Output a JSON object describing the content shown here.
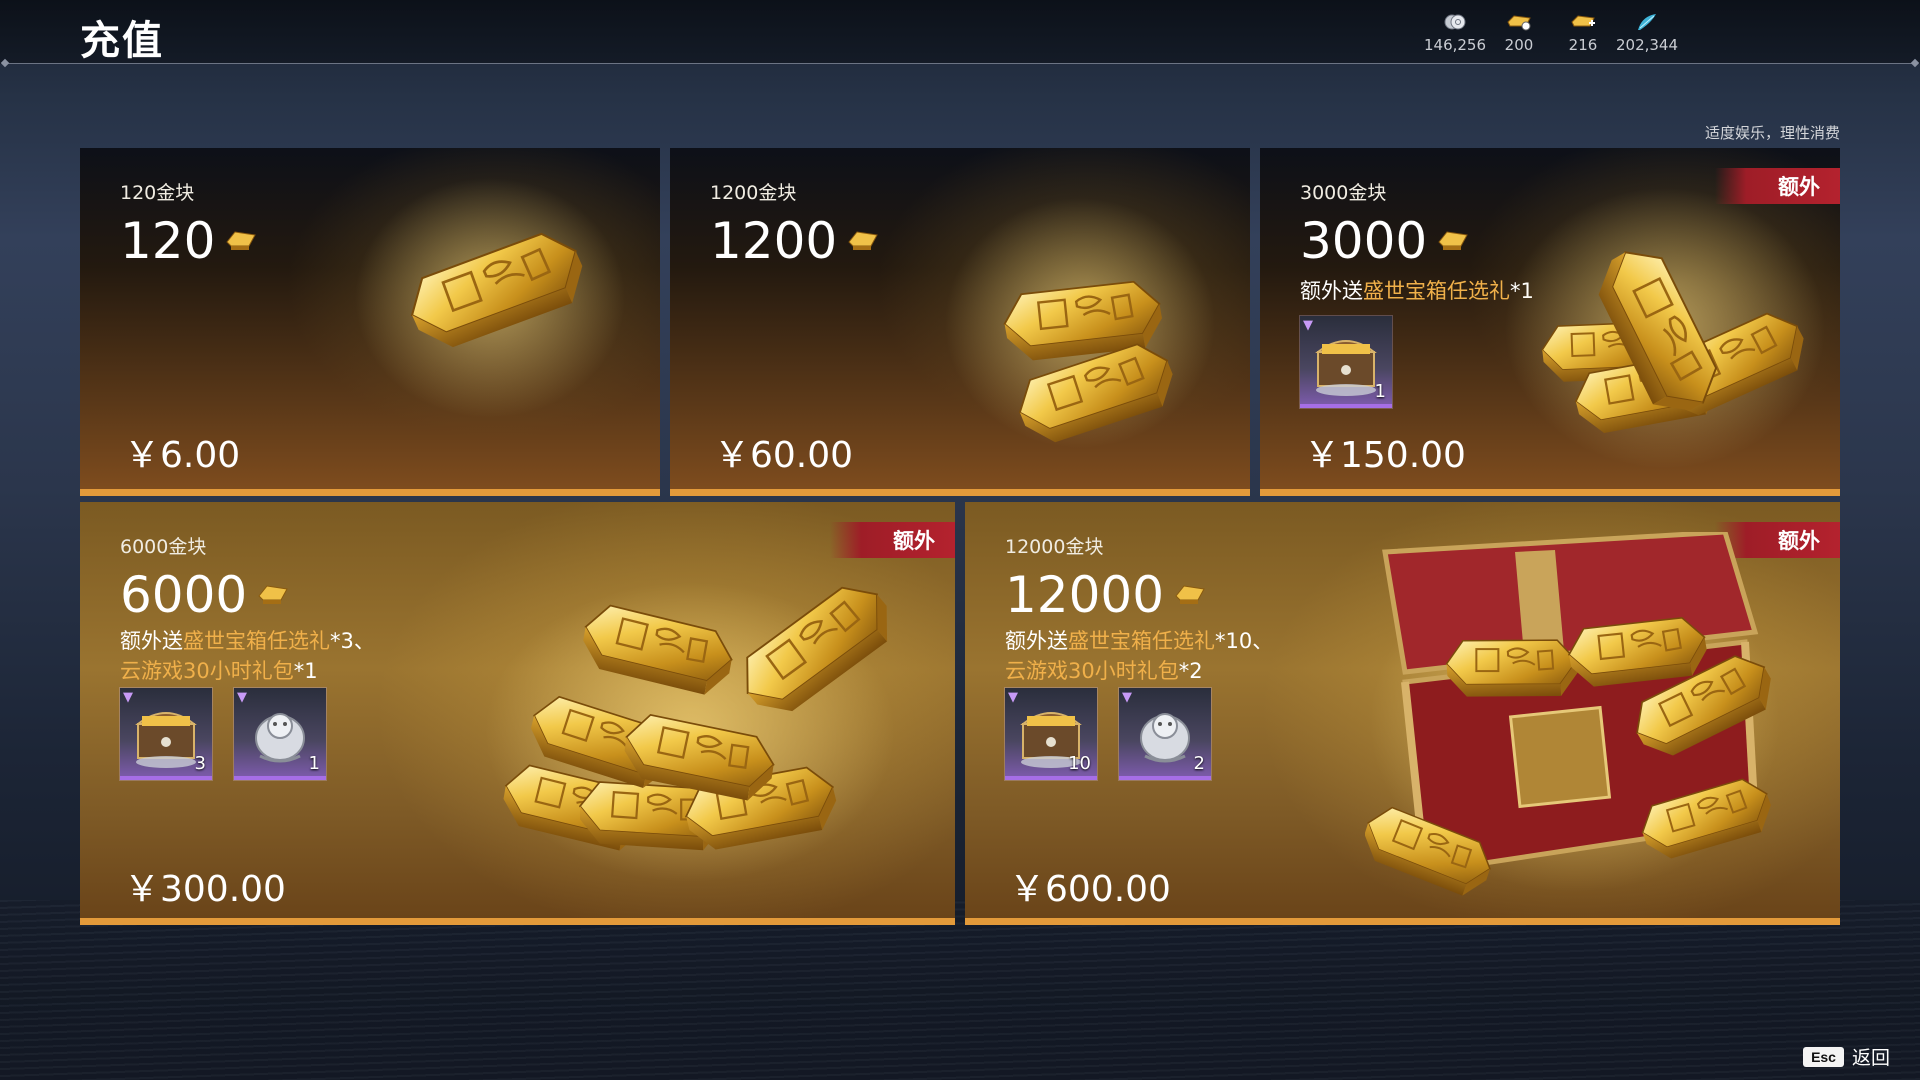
{
  "header": {
    "title": "充值",
    "currencies": [
      {
        "icon": "silver-coin-icon",
        "value": "146,256"
      },
      {
        "icon": "gold-ingot-small-icon",
        "value": "200"
      },
      {
        "icon": "gold-ingot-plus-icon",
        "value": "216"
      },
      {
        "icon": "blue-feather-icon",
        "value": "202,344"
      }
    ]
  },
  "notice": "适度娱乐，理性消费",
  "colors": {
    "accent": "#e39a3a",
    "highlight": "#f0b04a",
    "tag": "#b4222e"
  },
  "packages": [
    {
      "name": "120金块",
      "amount": "120",
      "price": "￥6.00"
    },
    {
      "name": "1200金块",
      "amount": "1200",
      "price": "￥60.00"
    },
    {
      "name": "3000金块",
      "amount": "3000",
      "price": "￥150.00",
      "tag": "额外",
      "bonus": {
        "prefix": "额外送",
        "item1": "盛世宝箱任选礼",
        "suffix1": "*1"
      },
      "items": [
        {
          "icon": "treasure-chest-icon",
          "count": "1"
        }
      ]
    },
    {
      "name": "6000金块",
      "amount": "6000",
      "price": "￥300.00",
      "tag": "额外",
      "bonus": {
        "prefix": "额外送",
        "item1": "盛世宝箱任选礼",
        "suffix1": "*3、",
        "item2": "云游戏30小时礼包",
        "suffix2": "*1"
      },
      "items": [
        {
          "icon": "treasure-chest-icon",
          "count": "3"
        },
        {
          "icon": "silver-lion-icon",
          "count": "1"
        }
      ]
    },
    {
      "name": "12000金块",
      "amount": "12000",
      "price": "￥600.00",
      "tag": "额外",
      "bonus": {
        "prefix": "额外送",
        "item1": "盛世宝箱任选礼",
        "suffix1": "*10、",
        "item2": "云游戏30小时礼包",
        "suffix2": "*2"
      },
      "items": [
        {
          "icon": "treasure-chest-icon",
          "count": "10"
        },
        {
          "icon": "silver-lion-icon",
          "count": "2"
        }
      ]
    }
  ],
  "footer": {
    "key": "Esc",
    "label": "返回"
  }
}
